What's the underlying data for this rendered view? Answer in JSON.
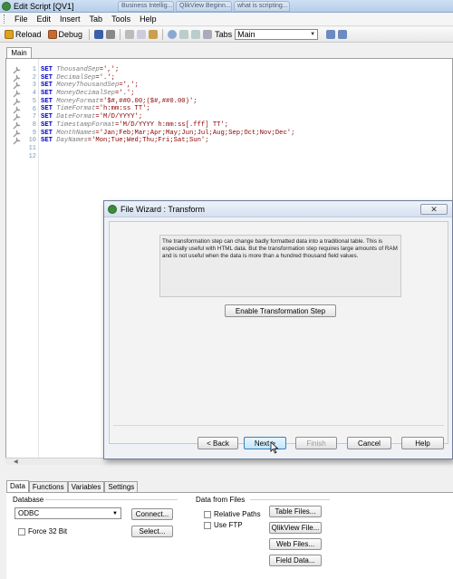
{
  "window": {
    "title": "Edit Script [QV1]",
    "background_tabs": [
      "Business Intellig...",
      "QlikView Beginn...",
      "what is scripting..."
    ]
  },
  "menu": [
    "File",
    "Edit",
    "Insert",
    "Tab",
    "Tools",
    "Help"
  ],
  "toolbar": {
    "reload_label": "Reload",
    "debug_label": "Debug",
    "tabs_label": "Tabs",
    "tabs_value": "Main"
  },
  "script_tabs": [
    "Main"
  ],
  "code_lines": [
    {
      "n": "1",
      "kw": "SET",
      "var": "ThousandSep",
      "val": "=',';"
    },
    {
      "n": "2",
      "kw": "SET",
      "var": "DecimalSep",
      "val": "='.';"
    },
    {
      "n": "3",
      "kw": "SET",
      "var": "MoneyThousandSep",
      "val": "=',';"
    },
    {
      "n": "4",
      "kw": "SET",
      "var": "MoneyDecimalSep",
      "val": "='.';"
    },
    {
      "n": "5",
      "kw": "SET",
      "var": "MoneyFormat",
      "val": "='$#,##0.00;($#,##0.00)';"
    },
    {
      "n": "6",
      "kw": "SET",
      "var": "TimeFormat",
      "val": "='h:mm:ss TT';"
    },
    {
      "n": "7",
      "kw": "SET",
      "var": "DateFormat",
      "val": "='M/D/YYYY';"
    },
    {
      "n": "8",
      "kw": "SET",
      "var": "TimestampFormat",
      "val": "='M/D/YYYY h:mm:ss[.fff] TT';"
    },
    {
      "n": "9",
      "kw": "SET",
      "var": "MonthNames",
      "val": "='Jan;Feb;Mar;Apr;May;Jun;Jul;Aug;Sep;Oct;Nov;Dec';"
    },
    {
      "n": "10",
      "kw": "SET",
      "var": "DayNames",
      "val": "='Mon;Tue;Wed;Thu;Fri;Sat;Sun';"
    },
    {
      "n": "11",
      "kw": "",
      "var": "",
      "val": ""
    },
    {
      "n": "12",
      "kw": "",
      "var": "",
      "val": ""
    }
  ],
  "bottom_tabs": [
    "Data",
    "Functions",
    "Variables",
    "Settings"
  ],
  "database": {
    "group_label": "Database",
    "selected": "ODBC",
    "connect_label": "Connect...",
    "select_label": "Select...",
    "force32_label": "Force 32 Bit"
  },
  "data_from_files": {
    "group_label": "Data from Files",
    "relative_paths_label": "Relative Paths",
    "use_ftp_label": "Use FTP",
    "table_files_label": "Table Files...",
    "qlikview_file_label": "QlikView File...",
    "web_files_label": "Web Files...",
    "field_data_label": "Field Data..."
  },
  "dialog": {
    "title": "File Wizard : Transform",
    "info_text": "The transformation step can change badly formatted data into a traditional table. This is especially useful with HTML data. But the transformation step requires large amounts of RAM and is not useful when the data is more than a hundred thousand field values.",
    "enable_label": "Enable Transformation Step",
    "back_label": "< Back",
    "next_label": "Next >",
    "finish_label": "Finish",
    "cancel_label": "Cancel",
    "help_label": "Help"
  },
  "colors": {
    "keyword": "#0000cc",
    "variable": "#7d7d7d",
    "string": "#8b0000",
    "primary_button_border": "#3c7fb1"
  }
}
